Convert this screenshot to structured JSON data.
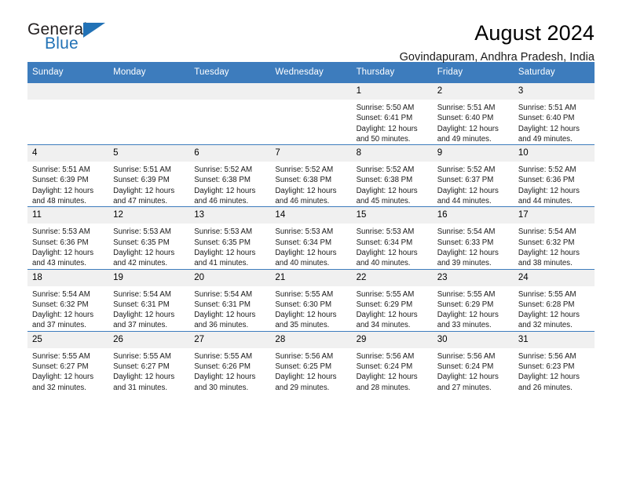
{
  "brand": {
    "name_part1": "General",
    "name_part2": "Blue",
    "logo_icon": "blue-triangle-flag-icon"
  },
  "header": {
    "title": "August 2024",
    "location": "Govindapuram, Andhra Pradesh, India"
  },
  "theme": {
    "header_blue": "#3d7cbd",
    "brand_blue": "#2272b6",
    "daynum_bg": "#f0f0f0",
    "text": "#1a1a1a"
  },
  "weekday_headers": [
    "Sunday",
    "Monday",
    "Tuesday",
    "Wednesday",
    "Thursday",
    "Friday",
    "Saturday"
  ],
  "labels": {
    "sunrise_prefix": "Sunrise: ",
    "sunset_prefix": "Sunset: ",
    "daylight_prefix": "Daylight: "
  },
  "weeks": [
    [
      {
        "day": "",
        "blank": true,
        "line1": "",
        "line2": "",
        "line3": "",
        "line4": ""
      },
      {
        "day": "",
        "blank": true,
        "line1": "",
        "line2": "",
        "line3": "",
        "line4": ""
      },
      {
        "day": "",
        "blank": true,
        "line1": "",
        "line2": "",
        "line3": "",
        "line4": ""
      },
      {
        "day": "",
        "blank": true,
        "line1": "",
        "line2": "",
        "line3": "",
        "line4": ""
      },
      {
        "day": "1",
        "blank": false,
        "line1": "Sunrise: 5:50 AM",
        "line2": "Sunset: 6:41 PM",
        "line3": "Daylight: 12 hours",
        "line4": "and 50 minutes."
      },
      {
        "day": "2",
        "blank": false,
        "line1": "Sunrise: 5:51 AM",
        "line2": "Sunset: 6:40 PM",
        "line3": "Daylight: 12 hours",
        "line4": "and 49 minutes."
      },
      {
        "day": "3",
        "blank": false,
        "line1": "Sunrise: 5:51 AM",
        "line2": "Sunset: 6:40 PM",
        "line3": "Daylight: 12 hours",
        "line4": "and 49 minutes."
      }
    ],
    [
      {
        "day": "4",
        "blank": false,
        "line1": "Sunrise: 5:51 AM",
        "line2": "Sunset: 6:39 PM",
        "line3": "Daylight: 12 hours",
        "line4": "and 48 minutes."
      },
      {
        "day": "5",
        "blank": false,
        "line1": "Sunrise: 5:51 AM",
        "line2": "Sunset: 6:39 PM",
        "line3": "Daylight: 12 hours",
        "line4": "and 47 minutes."
      },
      {
        "day": "6",
        "blank": false,
        "line1": "Sunrise: 5:52 AM",
        "line2": "Sunset: 6:38 PM",
        "line3": "Daylight: 12 hours",
        "line4": "and 46 minutes."
      },
      {
        "day": "7",
        "blank": false,
        "line1": "Sunrise: 5:52 AM",
        "line2": "Sunset: 6:38 PM",
        "line3": "Daylight: 12 hours",
        "line4": "and 46 minutes."
      },
      {
        "day": "8",
        "blank": false,
        "line1": "Sunrise: 5:52 AM",
        "line2": "Sunset: 6:38 PM",
        "line3": "Daylight: 12 hours",
        "line4": "and 45 minutes."
      },
      {
        "day": "9",
        "blank": false,
        "line1": "Sunrise: 5:52 AM",
        "line2": "Sunset: 6:37 PM",
        "line3": "Daylight: 12 hours",
        "line4": "and 44 minutes."
      },
      {
        "day": "10",
        "blank": false,
        "line1": "Sunrise: 5:52 AM",
        "line2": "Sunset: 6:36 PM",
        "line3": "Daylight: 12 hours",
        "line4": "and 44 minutes."
      }
    ],
    [
      {
        "day": "11",
        "blank": false,
        "line1": "Sunrise: 5:53 AM",
        "line2": "Sunset: 6:36 PM",
        "line3": "Daylight: 12 hours",
        "line4": "and 43 minutes."
      },
      {
        "day": "12",
        "blank": false,
        "line1": "Sunrise: 5:53 AM",
        "line2": "Sunset: 6:35 PM",
        "line3": "Daylight: 12 hours",
        "line4": "and 42 minutes."
      },
      {
        "day": "13",
        "blank": false,
        "line1": "Sunrise: 5:53 AM",
        "line2": "Sunset: 6:35 PM",
        "line3": "Daylight: 12 hours",
        "line4": "and 41 minutes."
      },
      {
        "day": "14",
        "blank": false,
        "line1": "Sunrise: 5:53 AM",
        "line2": "Sunset: 6:34 PM",
        "line3": "Daylight: 12 hours",
        "line4": "and 40 minutes."
      },
      {
        "day": "15",
        "blank": false,
        "line1": "Sunrise: 5:53 AM",
        "line2": "Sunset: 6:34 PM",
        "line3": "Daylight: 12 hours",
        "line4": "and 40 minutes."
      },
      {
        "day": "16",
        "blank": false,
        "line1": "Sunrise: 5:54 AM",
        "line2": "Sunset: 6:33 PM",
        "line3": "Daylight: 12 hours",
        "line4": "and 39 minutes."
      },
      {
        "day": "17",
        "blank": false,
        "line1": "Sunrise: 5:54 AM",
        "line2": "Sunset: 6:32 PM",
        "line3": "Daylight: 12 hours",
        "line4": "and 38 minutes."
      }
    ],
    [
      {
        "day": "18",
        "blank": false,
        "line1": "Sunrise: 5:54 AM",
        "line2": "Sunset: 6:32 PM",
        "line3": "Daylight: 12 hours",
        "line4": "and 37 minutes."
      },
      {
        "day": "19",
        "blank": false,
        "line1": "Sunrise: 5:54 AM",
        "line2": "Sunset: 6:31 PM",
        "line3": "Daylight: 12 hours",
        "line4": "and 37 minutes."
      },
      {
        "day": "20",
        "blank": false,
        "line1": "Sunrise: 5:54 AM",
        "line2": "Sunset: 6:31 PM",
        "line3": "Daylight: 12 hours",
        "line4": "and 36 minutes."
      },
      {
        "day": "21",
        "blank": false,
        "line1": "Sunrise: 5:55 AM",
        "line2": "Sunset: 6:30 PM",
        "line3": "Daylight: 12 hours",
        "line4": "and 35 minutes."
      },
      {
        "day": "22",
        "blank": false,
        "line1": "Sunrise: 5:55 AM",
        "line2": "Sunset: 6:29 PM",
        "line3": "Daylight: 12 hours",
        "line4": "and 34 minutes."
      },
      {
        "day": "23",
        "blank": false,
        "line1": "Sunrise: 5:55 AM",
        "line2": "Sunset: 6:29 PM",
        "line3": "Daylight: 12 hours",
        "line4": "and 33 minutes."
      },
      {
        "day": "24",
        "blank": false,
        "line1": "Sunrise: 5:55 AM",
        "line2": "Sunset: 6:28 PM",
        "line3": "Daylight: 12 hours",
        "line4": "and 32 minutes."
      }
    ],
    [
      {
        "day": "25",
        "blank": false,
        "line1": "Sunrise: 5:55 AM",
        "line2": "Sunset: 6:27 PM",
        "line3": "Daylight: 12 hours",
        "line4": "and 32 minutes."
      },
      {
        "day": "26",
        "blank": false,
        "line1": "Sunrise: 5:55 AM",
        "line2": "Sunset: 6:27 PM",
        "line3": "Daylight: 12 hours",
        "line4": "and 31 minutes."
      },
      {
        "day": "27",
        "blank": false,
        "line1": "Sunrise: 5:55 AM",
        "line2": "Sunset: 6:26 PM",
        "line3": "Daylight: 12 hours",
        "line4": "and 30 minutes."
      },
      {
        "day": "28",
        "blank": false,
        "line1": "Sunrise: 5:56 AM",
        "line2": "Sunset: 6:25 PM",
        "line3": "Daylight: 12 hours",
        "line4": "and 29 minutes."
      },
      {
        "day": "29",
        "blank": false,
        "line1": "Sunrise: 5:56 AM",
        "line2": "Sunset: 6:24 PM",
        "line3": "Daylight: 12 hours",
        "line4": "and 28 minutes."
      },
      {
        "day": "30",
        "blank": false,
        "line1": "Sunrise: 5:56 AM",
        "line2": "Sunset: 6:24 PM",
        "line3": "Daylight: 12 hours",
        "line4": "and 27 minutes."
      },
      {
        "day": "31",
        "blank": false,
        "line1": "Sunrise: 5:56 AM",
        "line2": "Sunset: 6:23 PM",
        "line3": "Daylight: 12 hours",
        "line4": "and 26 minutes."
      }
    ]
  ]
}
